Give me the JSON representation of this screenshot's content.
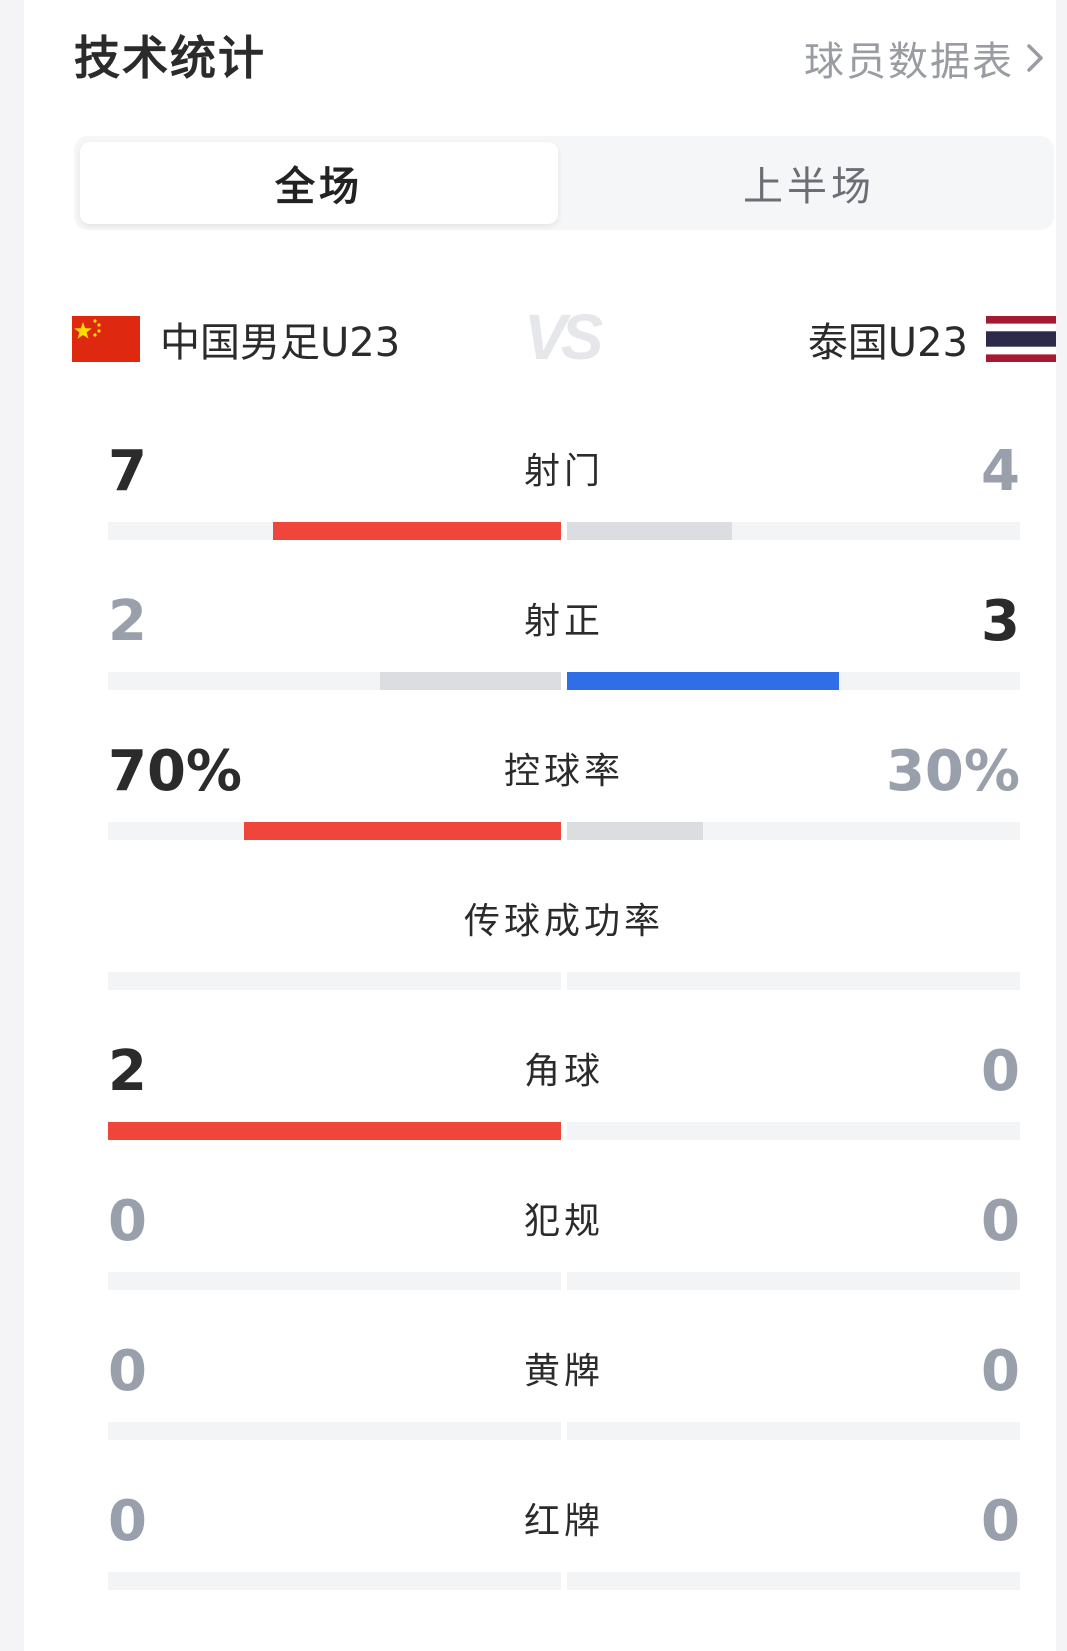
{
  "header": {
    "title": "技术统计",
    "player_data_link": "球员数据表"
  },
  "tabs": [
    {
      "label": "全场",
      "active": true
    },
    {
      "label": "上半场",
      "active": false
    }
  ],
  "teams": {
    "home": {
      "name": "中国男足U23",
      "flag": "china-flag-icon"
    },
    "away": {
      "name": "泰国U23",
      "flag": "thailand-flag-icon"
    },
    "vs_icon": "vs-icon"
  },
  "colors": {
    "home_bar": "#f0453b",
    "away_bar": "#2f6ee6",
    "trailing_bar": "#dcdde1",
    "track": "#f3f4f6"
  },
  "stats": [
    {
      "label": "射门",
      "home": "7",
      "away": "4",
      "home_share": 0.6364,
      "away_share": 0.3636,
      "leader": "home"
    },
    {
      "label": "射正",
      "home": "2",
      "away": "3",
      "home_share": 0.4,
      "away_share": 0.6,
      "leader": "away"
    },
    {
      "label": "控球率",
      "home": "70%",
      "away": "30%",
      "home_share": 0.7,
      "away_share": 0.3,
      "leader": "home"
    },
    {
      "label": "传球成功率",
      "home": "",
      "away": "",
      "home_share": 0,
      "away_share": 0,
      "leader": "none"
    },
    {
      "label": "角球",
      "home": "2",
      "away": "0",
      "home_share": 1.0,
      "away_share": 0,
      "leader": "home"
    },
    {
      "label": "犯规",
      "home": "0",
      "away": "0",
      "home_share": 0,
      "away_share": 0,
      "leader": "none"
    },
    {
      "label": "黄牌",
      "home": "0",
      "away": "0",
      "home_share": 0,
      "away_share": 0,
      "leader": "none"
    },
    {
      "label": "红牌",
      "home": "0",
      "away": "0",
      "home_share": 0,
      "away_share": 0,
      "leader": "none"
    }
  ]
}
